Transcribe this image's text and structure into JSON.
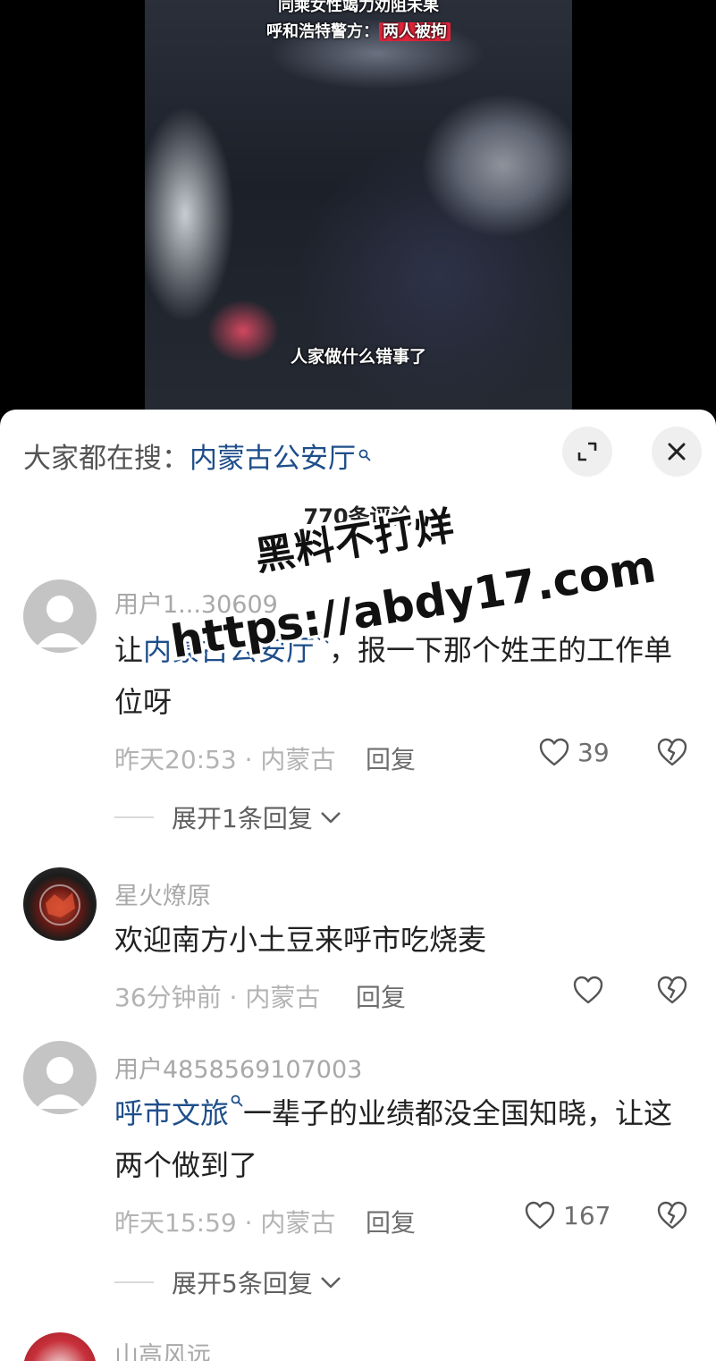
{
  "video": {
    "headline_line1": "同乘女性竭力劝阻未果",
    "headline_line2_prefix": "呼和浩特警方：",
    "headline_line2_tag": "两人被拘",
    "subtitle": "人家做什么错事了"
  },
  "sheet": {
    "search_prefix": "大家都在搜：",
    "search_keyword": "内蒙古公安厅",
    "comment_count": "770条评论"
  },
  "comments": [
    {
      "username": "用户1...30609",
      "text_prefix": "让",
      "link": "内蒙古公安厅",
      "text_suffix": "，报一下那个姓王的工作单位呀",
      "time_location": "昨天20:53 · 内蒙古",
      "reply_label": "回复",
      "likes": "39",
      "expand_label": "展开1条回复"
    },
    {
      "username": "星火燎原",
      "text": "欢迎南方小土豆来呼市吃烧麦",
      "time_location": "36分钟前 · 内蒙古",
      "reply_label": "回复",
      "likes": ""
    },
    {
      "username": "用户4858569107003",
      "link": "呼市文旅",
      "text_suffix": "一辈子的业绩都没全国知晓，让这两个做到了",
      "time_location": "昨天15:59 · 内蒙古",
      "reply_label": "回复",
      "likes": "167",
      "expand_label": "展开5条回复"
    },
    {
      "username": "山高风远"
    }
  ],
  "watermark": {
    "line1": "黑料不打烊",
    "line2": "https://abdy17.com"
  },
  "icons": {
    "search": "search-icon",
    "expand": "expand-icon",
    "close": "close-icon",
    "like": "heart-icon",
    "dislike": "broken-heart-icon",
    "chevron": "chevron-down-icon"
  },
  "colors": {
    "link": "#1e4e8a",
    "video_tag": "#e0243a",
    "meta_text": "#b3b3b3",
    "watermark_fill": "#111111"
  }
}
